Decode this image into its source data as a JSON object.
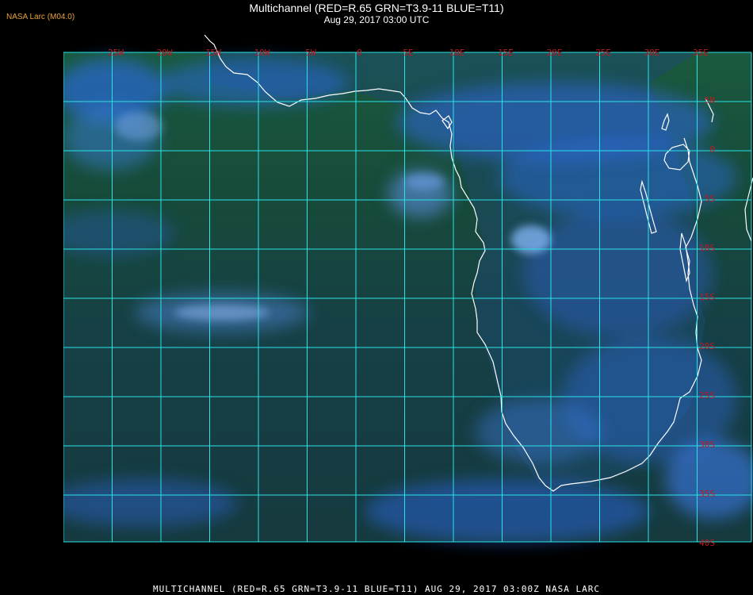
{
  "header": {
    "logo_text": "NASA Larc (M04.0)",
    "title": "Multichannel (RED=R.65 GRN=T3.9-11 BLUE=T11)",
    "subtitle": "Aug 29, 2017 03:00 UTC"
  },
  "footer": {
    "caption": "MULTICHANNEL (RED=R.65 GRN=T3.9-11 BLUE=T11) AUG 29, 2017 03:00Z   NASA LARC"
  },
  "map": {
    "grid_color": "#29e3e6",
    "label_color": "#c0181e",
    "coast_color": "#ffffff",
    "lon_labels": [
      "25W",
      "20W",
      "15W",
      "10W",
      "5W",
      "0",
      "5E",
      "10E",
      "15E",
      "20E",
      "25E",
      "30E",
      "35E"
    ],
    "lat_labels": [
      "5N",
      "0",
      "5S",
      "10S",
      "15S",
      "20S",
      "25S",
      "30S",
      "35S",
      "40S"
    ],
    "corner_label": "35E"
  }
}
